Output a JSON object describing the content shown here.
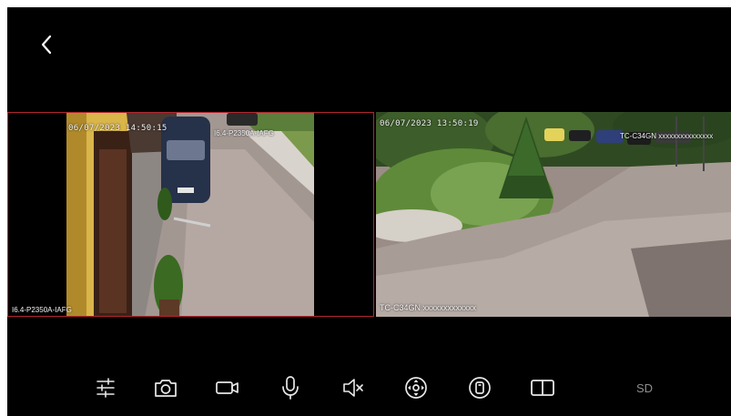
{
  "nav": {
    "back_icon": "chevron-left-icon"
  },
  "cameras": [
    {
      "timestamp": "06/07/2023 14:50:15",
      "overlay_label": "I6.4-P2350A-IAFG",
      "corner_label": "I6.4-P2350A-IAFG",
      "selected": true,
      "accent_color": "#b3262e"
    },
    {
      "timestamp": "06/07/2023 13:50:19",
      "overlay_label": "TC-C34GN xxxxxxxxxxxxx",
      "top_right_label": "TC-C34GN xxxxxxxxxxxxxxx",
      "selected": false
    }
  ],
  "toolbar": {
    "items": [
      {
        "name": "settings-sliders",
        "icon": "sliders-icon"
      },
      {
        "name": "snapshot",
        "icon": "camera-icon"
      },
      {
        "name": "record",
        "icon": "video-icon"
      },
      {
        "name": "talk",
        "icon": "microphone-icon"
      },
      {
        "name": "mute",
        "icon": "speaker-muted-icon"
      },
      {
        "name": "ptz",
        "icon": "ptz-control-icon"
      },
      {
        "name": "device-view",
        "icon": "device-icon"
      },
      {
        "name": "split-view",
        "icon": "split-screen-icon"
      }
    ],
    "quality_label": "SD",
    "icon_color": "#e8e8e8",
    "quality_color": "#8e8e8e"
  }
}
